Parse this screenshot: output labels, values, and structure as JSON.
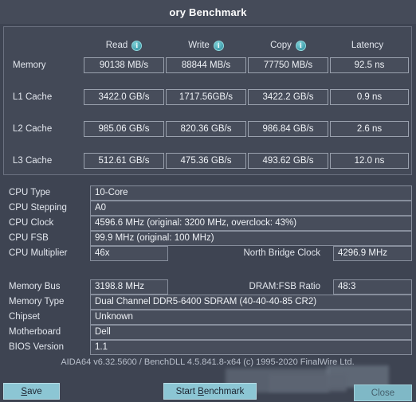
{
  "window": {
    "title": "ory Benchmark"
  },
  "benchmark": {
    "columns": [
      {
        "label": "Read",
        "icon": "info-icon",
        "has_info": true
      },
      {
        "label": "Write",
        "icon": "info-icon",
        "has_info": true
      },
      {
        "label": "Copy",
        "icon": "info-icon",
        "has_info": true
      },
      {
        "label": "Latency",
        "icon": "",
        "has_info": false
      }
    ],
    "info_glyph": "i",
    "rows": [
      {
        "label": "Memory",
        "read": "90138 MB/s",
        "write": "88844 MB/s",
        "copy": "77750 MB/s",
        "latency": "92.5 ns"
      },
      {
        "label": "L1 Cache",
        "read": "3422.0 GB/s",
        "write": "1717.56GB/s",
        "copy": "3422.2 GB/s",
        "latency": "0.9 ns"
      },
      {
        "label": "L2 Cache",
        "read": "985.06 GB/s",
        "write": "820.36 GB/s",
        "copy": "986.84 GB/s",
        "latency": "2.6 ns"
      },
      {
        "label": "L3 Cache",
        "read": "512.61 GB/s",
        "write": "475.36 GB/s",
        "copy": "493.62 GB/s",
        "latency": "12.0 ns"
      }
    ]
  },
  "system": {
    "cpu_type_label": "CPU Type",
    "cpu_type_value": "10-Core",
    "cpu_stepping_label": "CPU Stepping",
    "cpu_stepping_value": "A0",
    "cpu_clock_label": "CPU Clock",
    "cpu_clock_value": "4596.6 MHz  (original: 3200 MHz, overclock: 43%)",
    "cpu_fsb_label": "CPU FSB",
    "cpu_fsb_value": "99.9 MHz  (original: 100 MHz)",
    "cpu_multiplier_label": "CPU Multiplier",
    "cpu_multiplier_value": "46x",
    "north_bridge_label": "North Bridge Clock",
    "north_bridge_value": "4296.9 MHz",
    "memory_bus_label": "Memory Bus",
    "memory_bus_value": "3198.8 MHz",
    "dram_fsb_label": "DRAM:FSB Ratio",
    "dram_fsb_value": "48:3",
    "memory_type_label": "Memory Type",
    "memory_type_value": "Dual Channel DDR5-6400 SDRAM  (40-40-40-85 CR2)",
    "chipset_label": "Chipset",
    "chipset_value": "Unknown",
    "motherboard_label": "Motherboard",
    "motherboard_value": "Dell",
    "bios_label": "BIOS Version",
    "bios_value": "1.1"
  },
  "version": {
    "text": "AIDA64 v6.32.5600 / BenchDLL 4.5.841.8-x64  (c) 1995-2020 FinalWire Ltd."
  },
  "footer": {
    "save_label": "Save",
    "save_accel": "S",
    "start_label": "Start Benchmark",
    "start_accel": "B",
    "close_label": "Close"
  },
  "colors": {
    "background": "#3e4452",
    "panel": "#434957",
    "field": "#474d5b",
    "border": "#878e9c",
    "text": "#e2e6ed",
    "button": "#8cc6d4",
    "info_icon": "#4aa6b4"
  }
}
